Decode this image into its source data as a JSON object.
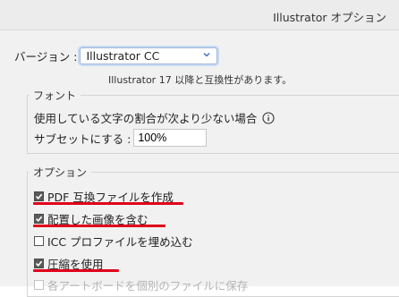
{
  "window": {
    "title": "Illustrator オプション"
  },
  "version": {
    "label": "バージョン :",
    "selected": "Illustrator CC",
    "note": "Illustrator 17 以降と互換性があります。"
  },
  "fonts": {
    "legend": "フォント",
    "subset_line1": "使用している文字の割合が次より少ない場合",
    "subset_line2": "サブセットにする :",
    "subset_value": "100%"
  },
  "options": {
    "legend": "オプション",
    "items": [
      {
        "label": "PDF 互換ファイルを作成",
        "checked": true,
        "enabled": true,
        "highlighted": true
      },
      {
        "label": "配置した画像を含む",
        "checked": true,
        "enabled": true,
        "highlighted": true
      },
      {
        "label": "ICC プロファイルを埋め込む",
        "checked": false,
        "enabled": true,
        "highlighted": false
      },
      {
        "label": "圧縮を使用",
        "checked": true,
        "enabled": true,
        "highlighted": true
      },
      {
        "label": "各アートボードを個別のファイルに保存",
        "checked": false,
        "enabled": false,
        "highlighted": false
      }
    ]
  },
  "colors": {
    "highlight_underline": "#e0001b",
    "dialog_background": "#f1f1f1",
    "titlebar_background": "#ececec",
    "focus_ring": "#c9dbf4"
  },
  "icons": {
    "info": "info-circle-icon",
    "dropdown": "chevron-down-icon",
    "checkmark": "checkmark-icon"
  }
}
